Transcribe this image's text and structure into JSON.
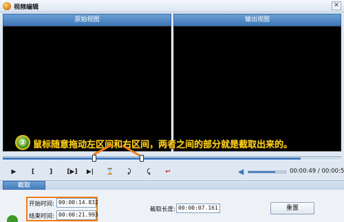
{
  "window": {
    "title": "视频编辑"
  },
  "panels": {
    "source_label": "原始视图",
    "output_label": "输出视图"
  },
  "annotation": {
    "number": "②",
    "text": "鼠标随意拖动左区间和右区间，两者之间的部分就是截取出来的。"
  },
  "timeline": {
    "progress_fraction": 0.88,
    "left_marker_fraction": 0.27,
    "right_marker_fraction": 0.41
  },
  "controls": {
    "play": "▶",
    "mark_start": "[",
    "mark_end": "]",
    "play_selection": "[▶]",
    "step": "▶|",
    "cut": "⌛",
    "rotate_left": "⤸",
    "rotate_right": "⤹",
    "undo": "↩"
  },
  "volume": {
    "level_fraction": 0.72
  },
  "time": {
    "current": "00:00:49",
    "total": "00:00:55"
  },
  "tabs": [
    {
      "label": "截取"
    }
  ],
  "trim": {
    "start_label": "开始时间:",
    "start_value": "00:00:14.832",
    "end_label": "结束时间:",
    "end_value": "00:00:21.993",
    "length_label": "截取长度:",
    "length_value": "00:00:07.161",
    "reset_label": "重置"
  },
  "colors": {
    "accent": "#3f79c0",
    "highlight": "#f07c16",
    "annotation": "#ffd21a"
  }
}
